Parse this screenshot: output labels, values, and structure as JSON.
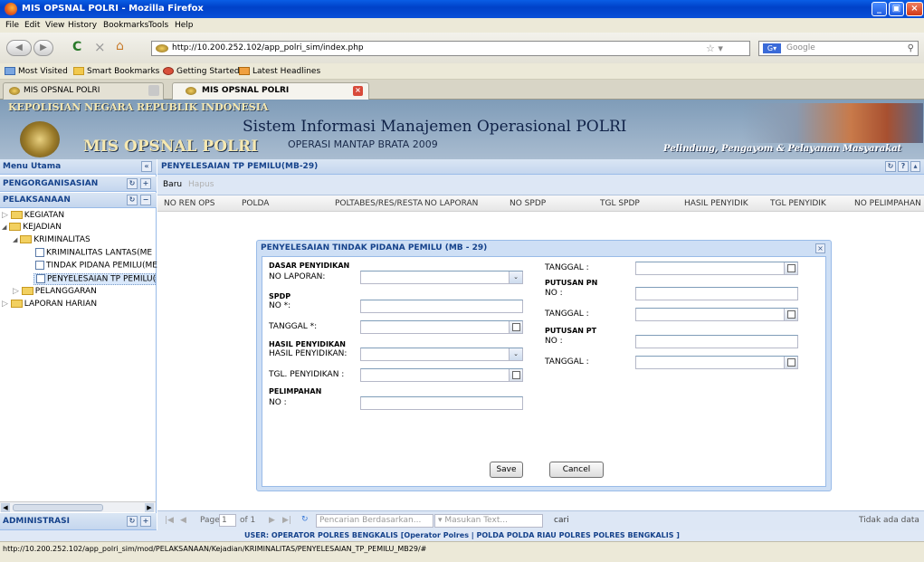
{
  "window": {
    "title": "MIS OPSNAL POLRI - Mozilla Firefox"
  },
  "menubar": [
    "File",
    "Edit",
    "View",
    "History",
    "Bookmarks",
    "Tools",
    "Help"
  ],
  "navbar": {
    "url": "http://10.200.252.102/app_polri_sim/index.php",
    "search_placeholder": "Google"
  },
  "bookmarks": [
    "Most Visited",
    "Smart Bookmarks",
    "Getting Started",
    "Latest Headlines"
  ],
  "tabs": [
    {
      "label": "MIS OPSNAL POLRI"
    },
    {
      "label": "MIS OPSNAL POLRI"
    }
  ],
  "banner": {
    "org": "KEPOLISIAN NEGARA REPUBLIK INDONESIA",
    "app": "MIS OPSNAL POLRI",
    "system": "Sistem Informasi Manajemen Operasional POLRI",
    "operation": "OPERASI MANTAP BRATA 2009",
    "motto": "Pelindung, Pengayom & Pelayanan Masyarakat"
  },
  "left": {
    "title": "Menu Utama",
    "collapse": "«",
    "sections": [
      "PENGORGANISASIAN",
      "PELAKSANAAN",
      "ADMINISTRASI"
    ],
    "tree": [
      {
        "label": "KEGIATAN",
        "arrow": "▷"
      },
      {
        "label": "KEJADIAN",
        "arrow": "◢"
      },
      {
        "label": "KRIMINALITAS",
        "arrow": "◢"
      },
      {
        "label": "KRIMINALITAS LANTAS(ME"
      },
      {
        "label": "TINDAK PIDANA PEMILU(ME"
      },
      {
        "label": "PENYELESAIAN TP PEMILU("
      },
      {
        "label": "PELANGGARAN",
        "arrow": "▷"
      },
      {
        "label": "LAPORAN HARIAN",
        "arrow": "▷"
      }
    ]
  },
  "main": {
    "title": "PENYELESAIAN TP PEMILU(MB-29)",
    "toolbar": {
      "new": "Baru",
      "delete": "Hapus"
    },
    "columns": [
      "NO REN OPS",
      "POLDA",
      "POLTABES/RES/RESTA",
      "NO LAPORAN",
      "NO SPDP",
      "TGL SPDP",
      "HASIL PENYIDIK",
      "TGL PENYIDIK",
      "NO PELIMPAHAN"
    ],
    "paging": {
      "page_label": "Page",
      "page_value": "1",
      "of_label": "of 1",
      "search_by": "Pencarian Berdasarkan...",
      "search_text": "Masukan Text...",
      "search_btn": "cari",
      "empty": "Tidak ada data"
    }
  },
  "dialog": {
    "title": "PENYELESAIAN TINDAK PIDANA PEMILU (MB - 29)",
    "close": "×",
    "left_fields": {
      "dasar": "DASAR PENYIDIKAN",
      "no_laporan": "NO LAPORAN:",
      "spdp": "SPDP",
      "no": "NO *:",
      "tanggal_req": "TANGGAL *:",
      "hasil": "HASIL PENYIDIKAN",
      "hasil_penyidikan": "HASIL PENYIDIKAN:",
      "tgl_penyidikan": "TGL. PENYIDIKAN :",
      "pelimpahan": "PELIMPAHAN",
      "no2": "NO :"
    },
    "right_fields": {
      "tanggal1": "TANGGAL :",
      "putusan_pn": "PUTUSAN PN",
      "no_pn": "NO :",
      "tanggal_pn": "TANGGAL :",
      "putusan_pt": "PUTUSAN PT",
      "no_pt": "NO :",
      "tanggal_pt": "TANGGAL :"
    },
    "save": "Save",
    "cancel": "Cancel"
  },
  "user_line": "USER: OPERATOR POLRES BENGKALIS [Operator Polres | POLDA POLDA RIAU POLRES POLRES BENGKALIS ]",
  "status_url": "http://10.200.252.102/app_polri_sim/mod/PELAKSANAAN/Kejadian/KRIMINALITAS/PENYELESAIAN_TP_PEMILU_MB29/#"
}
